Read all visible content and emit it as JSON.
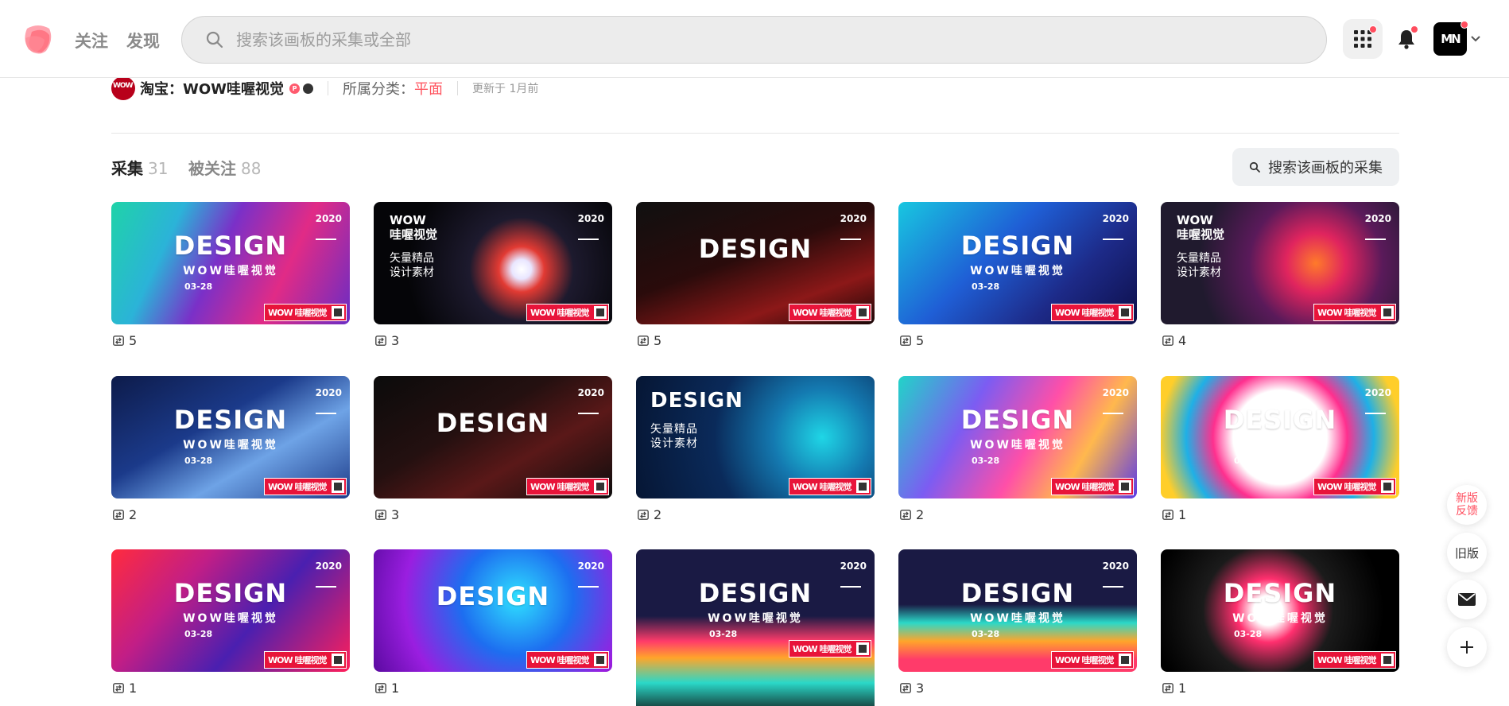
{
  "header": {
    "nav": [
      "关注",
      "发现"
    ],
    "search_placeholder": "搜索该画板的采集或全部",
    "avatar_initials": "MN"
  },
  "board": {
    "owner_logo_text": "WOW",
    "owner_name": "淘宝：WOW哇喔视觉",
    "owner_badge": "P",
    "category_label": "所属分类：",
    "category_value": "平面",
    "updated": "更新于 1月前"
  },
  "tabs": {
    "pins_label": "采集",
    "pins_count": "31",
    "followers_label": "被关注",
    "followers_count": "88"
  },
  "board_search_label": "搜索该画板的采集",
  "pins": [
    {
      "title": "DESIGN",
      "subtitle": "WOW哇喔视觉",
      "year": "2020",
      "date": "03-28",
      "repins": "5",
      "bg": "linear-gradient(115deg,#1fd3a8 0%,#2bb3d8 25%,#7a30c8 45%,#e12b86 70%,#6a2cc4 100%)"
    },
    {
      "title": "WOW\n哇喔视觉",
      "subtitle": "矢量精品\n设计素材",
      "year": "2020",
      "date": "",
      "repins": "3",
      "bg": "radial-gradient(circle at 62% 55%,#ffffff 0%,#e9e6ff 6%,#e23a33 14%,#1d1a2e 32%,#050508 70%)"
    },
    {
      "title": "DESIGN",
      "subtitle": "",
      "year": "2020",
      "date": "",
      "repins": "5",
      "bg": "linear-gradient(160deg,#101010 0%,#2a0b0b 45%,#8c1818 75%,#1a0707 100%)"
    },
    {
      "title": "DESIGN",
      "subtitle": "WOW哇喔视觉",
      "year": "2020",
      "date": "03-28",
      "repins": "5",
      "bg": "linear-gradient(135deg,#18c7e0 0%,#1f5fd6 40%,#1d2a88 70%,#0d0f4a 100%)"
    },
    {
      "title": "WOW\n哇喔视觉",
      "subtitle": "矢量精品\n设计素材",
      "year": "2020",
      "date": "",
      "repins": "4",
      "bg": "radial-gradient(circle at 65% 50%,#ff7a2a 0%,#e0245e 18%,#5a1a5a 40%,#201a2e 70%)"
    },
    {
      "title": "DESIGN",
      "subtitle": "WOW哇喔视觉",
      "year": "2020",
      "date": "03-28",
      "repins": "2",
      "bg": "linear-gradient(150deg,#0d1b4a 0%,#1b3a8a 40%,#6ea3e6 65%,#1e3c8a 100%)"
    },
    {
      "title": "DESIGN",
      "subtitle": "",
      "year": "2020",
      "date": "",
      "repins": "3",
      "bg": "linear-gradient(150deg,#0b0b0b 0%,#241010 40%,#5a1818 65%,#0d0d0d 100%)"
    },
    {
      "title": "DESIGN",
      "subtitle": "矢量精品\n设计素材",
      "year": "",
      "date": "",
      "repins": "2",
      "bg": "radial-gradient(circle at 78% 50%,#1fd6e6 0%,#1479b0 25%,#0a2a5a 55%,#061634 100%)"
    },
    {
      "title": "DESIGN",
      "subtitle": "WOW哇喔视觉",
      "year": "2020",
      "date": "03-28",
      "repins": "2",
      "bg": "linear-gradient(120deg,#21d4c8 0%,#7c5cf2 30%,#ff4fa8 55%,#ffb84d 75%,#5a3ae8 100%)"
    },
    {
      "title": "DESIGN",
      "subtitle": "WOW哇喔视觉",
      "year": "2020",
      "date": "03-28",
      "repins": "1",
      "bg": "radial-gradient(circle at 50% 50%,#ffffff 0%,#ffffff 35%,#ff2f8e 50%,#1fb0e6 70%,#ffce2a 90%)"
    },
    {
      "title": "DESIGN",
      "subtitle": "WOW哇喔视觉",
      "year": "2020",
      "date": "03-28",
      "repins": "1",
      "bg": "linear-gradient(130deg,#ff2b3e 0%,#c21e86 30%,#4a1fb0 60%,#ff1f5a 100%)"
    },
    {
      "title": "DESIGN",
      "subtitle": "",
      "year": "2020",
      "date": "",
      "repins": "1",
      "bg": "radial-gradient(circle at 60% 40%,#2fe1ff 0%,#1d6ef0 35%,#9a1ee0 70%,#5a0aa0 100%)"
    },
    {
      "title": "DESIGN",
      "subtitle": "WOW哇喔视觉",
      "year": "2020",
      "date": "03-28",
      "repins": "",
      "bg": "linear-gradient(180deg,#1a1a44 0%,#1a1a44 40%,#ff3b6a 55%,#ffa52a 65%,#2ad8c8 80%,#101010 100%)"
    },
    {
      "title": "DESIGN",
      "subtitle": "WOW哇喔视觉",
      "year": "2020",
      "date": "03-28",
      "repins": "3",
      "bg": "linear-gradient(180deg,#1a1a44 0%,#1a1a44 45%,#2ad8c8 60%,#ffa52a 75%,#ff3b6a 90%)"
    },
    {
      "title": "DESIGN",
      "subtitle": "WOW哇喔视觉",
      "year": "",
      "date": "03-28",
      "repins": "1",
      "bg": "radial-gradient(circle at 45% 50%,#ffffff 0%,#ffffff 10%,#ff2f6e 22%,#1b1b1b 45%,#000000 80%)"
    }
  ],
  "brand_mark": "WOW 哇喔视觉",
  "float_buttons": {
    "feedback": "新版\n反馈",
    "old_version": "旧版"
  },
  "colors": {
    "accent": "#ff5560",
    "notification_dot": "#ff4d5e"
  }
}
